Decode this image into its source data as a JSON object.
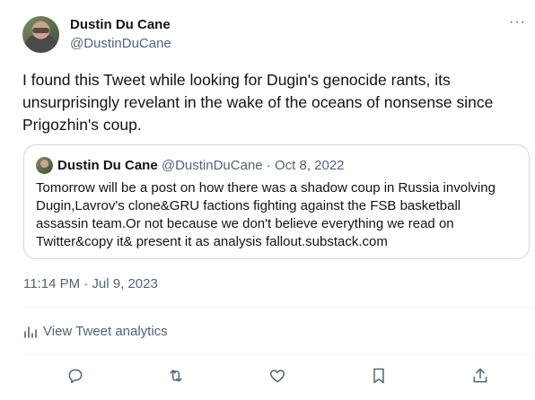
{
  "author": {
    "name": "Dustin Du Cane",
    "handle": "@DustinDuCane"
  },
  "more_icon": "···",
  "tweet": {
    "text": "I found this Tweet while looking for Dugin's genocide rants, its unsurprisingly revelant in the wake of the oceans of nonsense since Prigozhin's coup.",
    "timestamp": "11:14 PM · Jul 9, 2023"
  },
  "quote": {
    "name": "Dustin Du Cane",
    "meta": "@DustinDuCane · Oct 8, 2022",
    "text": "Tomorrow will be a post on how there was a shadow coup in Russia involving Dugin,Lavrov's clone&GRU factions fighting against the FSB basketball assassin team.Or not because we don't believe everything we read on Twitter&copy it& present it as analysis fallout.substack.com"
  },
  "analytics": {
    "label": "View Tweet analytics",
    "icon": "bar-chart-icon"
  },
  "actions": [
    {
      "name": "reply",
      "icon": "reply-icon"
    },
    {
      "name": "retweet",
      "icon": "retweet-icon"
    },
    {
      "name": "like",
      "icon": "heart-icon"
    },
    {
      "name": "bookmark",
      "icon": "bookmark-icon"
    },
    {
      "name": "share",
      "icon": "share-icon"
    }
  ],
  "colors": {
    "text": "#0f1419",
    "secondary": "#536471",
    "border": "#cfd9de"
  }
}
